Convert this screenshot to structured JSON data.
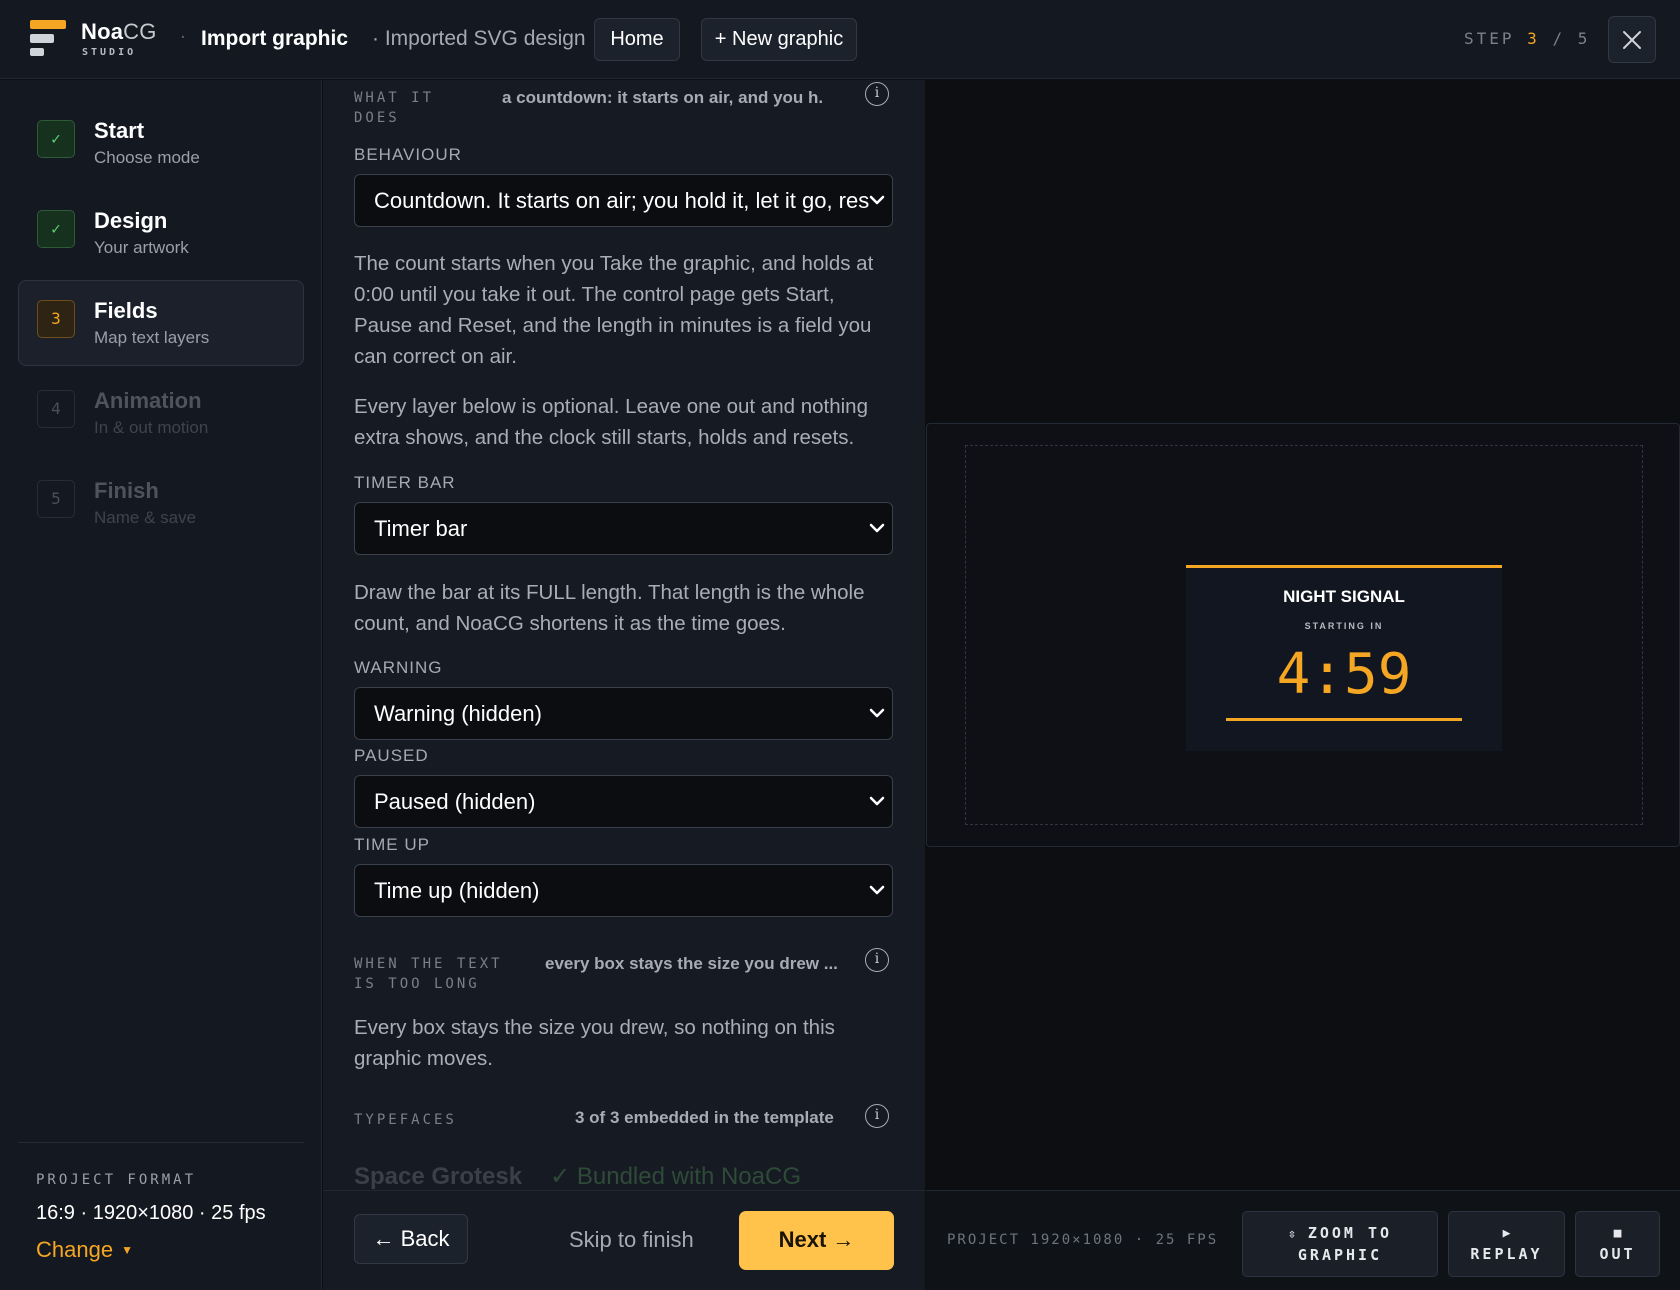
{
  "app": {
    "brand_main": "Noa",
    "brand_accent": "CG",
    "brand_sub": "STUDIO",
    "accent_color": "#f5a623"
  },
  "header": {
    "title": "Import graphic",
    "subtitle": "· Imported SVG design",
    "home_label": "Home",
    "new_label": "+ New graphic",
    "step_word": "STEP",
    "step_current": "3",
    "step_sep": "/",
    "step_total": "5",
    "close_icon": "close-icon"
  },
  "sidebar": {
    "steps": [
      {
        "badge": "✓",
        "title": "Start",
        "sub": "Choose mode",
        "state": "done"
      },
      {
        "badge": "✓",
        "title": "Design",
        "sub": "Your artwork",
        "state": "done"
      },
      {
        "badge": "3",
        "title": "Fields",
        "sub": "Map text layers",
        "state": "active"
      },
      {
        "badge": "4",
        "title": "Animation",
        "sub": "In & out motion",
        "state": "todo"
      },
      {
        "badge": "5",
        "title": "Finish",
        "sub": "Name & save",
        "state": "todo"
      }
    ],
    "project_format_label": "PROJECT FORMAT",
    "project_format_value": "16:9 · 1920×1080 · 25 fps",
    "change_label": "Change",
    "change_caret": "▼"
  },
  "form": {
    "what_label": "WHAT IT\nDOES",
    "what_summary": "a countdown: it starts on air, and you h...",
    "behaviour_label": "BEHAVIOUR",
    "behaviour_value": "Countdown. It starts on air; you hold it, let it go, reset it",
    "behaviour_desc": "The count starts when you Take the graphic, and holds at 0:00 until you take it out. The control page gets Start, Pause and Reset, and the length in minutes is a field you can correct on air.",
    "optional_desc": "Every layer below is optional. Leave one out and nothing extra shows, and the clock still starts, holds and resets.",
    "timer_bar_label": "TIMER BAR",
    "timer_bar_value": "Timer bar",
    "timer_bar_desc": "Draw the bar at its FULL length. That length is the whole count, and NoaCG shortens it as the time goes.",
    "warning_label": "WARNING",
    "warning_value": "Warning (hidden)",
    "paused_label": "PAUSED",
    "paused_value": "Paused (hidden)",
    "time_up_label": "TIME UP",
    "time_up_value": "Time up (hidden)",
    "long_label": "WHEN THE TEXT\nIS TOO LONG",
    "long_summary": "every box stays the size you drew ...",
    "long_desc": "Every box stays the size you drew, so nothing on this graphic moves.",
    "typefaces_label": "TYPEFACES",
    "typefaces_summary": "3 of 3 embedded in the template",
    "font_name": "Space Grotesk",
    "font_status": "✓ Bundled with NoaCG",
    "info_glyph": "i"
  },
  "footer": {
    "back_label": "← Back",
    "skip_label": "Skip to finish",
    "next_label": "Next →"
  },
  "preview": {
    "card_title": "NIGHT SIGNAL",
    "card_sub": "STARTING IN",
    "card_clock": "4:59",
    "timer_fraction": 1.0,
    "project_info": "PROJECT 1920×1080 · 25 FPS",
    "zoom_icon": "⇳",
    "zoom_label": "ZOOM TO\nGRAPHIC",
    "replay_icon": "▶",
    "replay_label": "REPLAY",
    "out_icon": "■",
    "out_label": "OUT"
  }
}
